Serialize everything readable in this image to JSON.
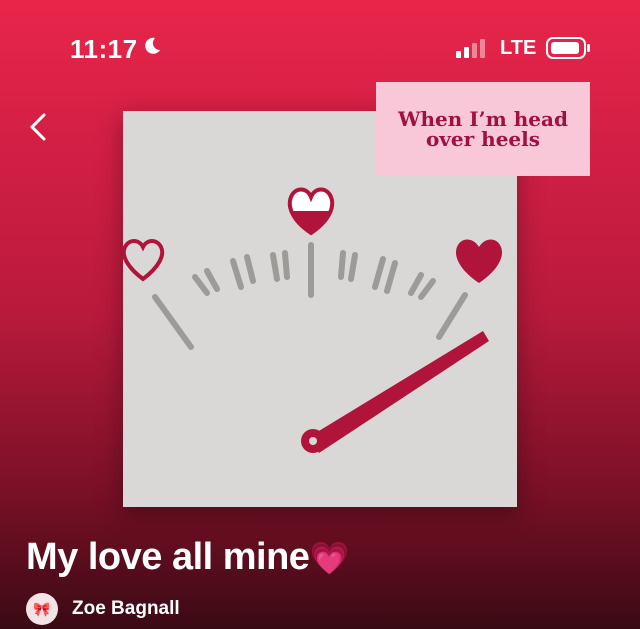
{
  "status_bar": {
    "time": "11:17",
    "network": "LTE",
    "icons": [
      "moon-icon",
      "signal-icon",
      "battery-icon"
    ]
  },
  "navigation": {
    "back_icon": "chevron-left-icon"
  },
  "artwork": {
    "caption": "When I’m head over heels",
    "colors": {
      "accent": "#b0143a",
      "paper": "#d9d8d6",
      "caption_bg": "#f8c8d8",
      "caption_text": "#a01040"
    }
  },
  "playlist": {
    "title": "My love all mine",
    "title_emoji": "💗",
    "owner": "Zoe Bagnall",
    "avatar_glyph": "🎀"
  }
}
